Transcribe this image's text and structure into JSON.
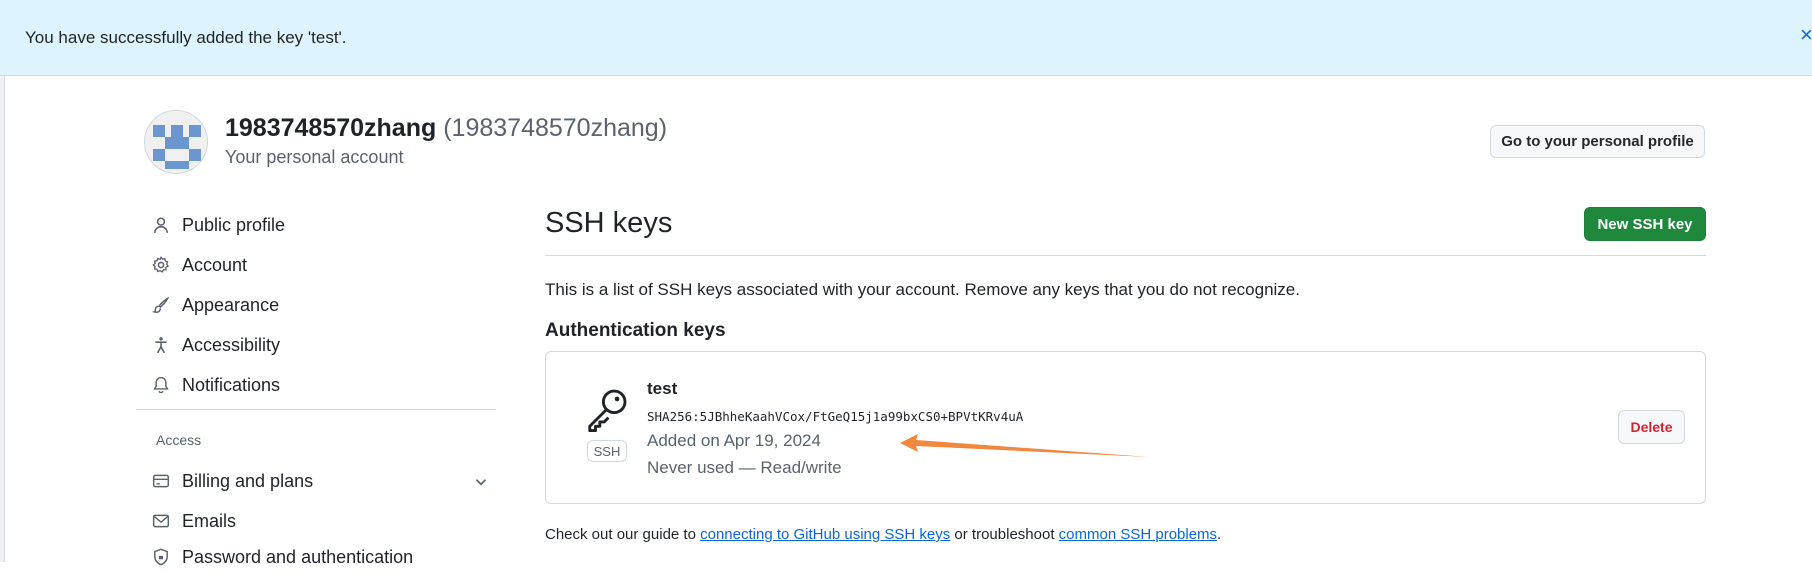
{
  "flash": {
    "message": "You have successfully added the key 'test'.",
    "close_glyph": "×"
  },
  "header": {
    "account_name": "1983748570zhang",
    "account_login": "(1983748570zhang)",
    "account_sub": "Your personal account",
    "profile_button": "Go to your personal profile"
  },
  "sidebar": {
    "items": [
      {
        "label": "Public profile",
        "icon": "person-icon"
      },
      {
        "label": "Account",
        "icon": "gear-icon"
      },
      {
        "label": "Appearance",
        "icon": "paintbrush-icon"
      },
      {
        "label": "Accessibility",
        "icon": "accessibility-icon"
      },
      {
        "label": "Notifications",
        "icon": "bell-icon"
      }
    ],
    "group_label": "Access",
    "access_items": [
      {
        "label": "Billing and plans",
        "icon": "credit-card-icon"
      },
      {
        "label": "Emails",
        "icon": "mail-icon"
      },
      {
        "label": "Password and authentication",
        "icon": "shield-lock-icon"
      }
    ]
  },
  "main": {
    "title": "SSH keys",
    "new_button": "New SSH key",
    "intro": "This is a list of SSH keys associated with your account. Remove any keys that you do not recognize.",
    "section_title": "Authentication keys",
    "key": {
      "title": "test",
      "fingerprint": "SHA256:5JBhheKaahVCox/FtGeQ15j1a99bxCS0+BPVtKRv4uA",
      "badge": "SSH",
      "added": "Added on Apr 19, 2024",
      "usage": "Never used — Read/write",
      "delete_button": "Delete"
    },
    "footer": {
      "prefix": "Check out our guide to ",
      "link1": "connecting to GitHub using SSH keys",
      "middle": " or troubleshoot ",
      "link2": "common SSH problems",
      "suffix": "."
    }
  },
  "colors": {
    "flash_bg": "#ddf4ff",
    "primary_green": "#1f883d",
    "danger_red": "#d1242f",
    "link_blue": "#0969da",
    "annotation_arrow": "#f0883e"
  }
}
